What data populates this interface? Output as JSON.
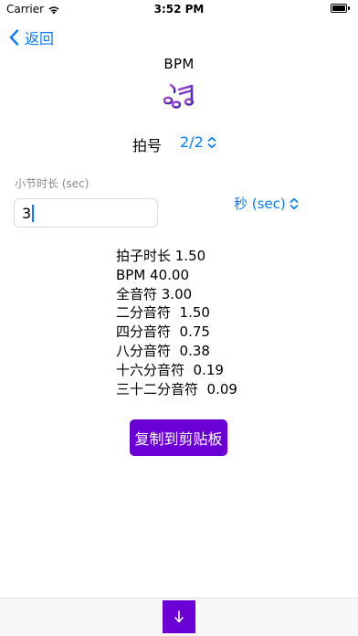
{
  "status_bar": {
    "carrier": "Carrier",
    "time": "3:52 PM"
  },
  "nav": {
    "back_label": "返回"
  },
  "header": {
    "title": "BPM"
  },
  "meter": {
    "label": "拍号",
    "value": "2/2"
  },
  "measure_duration": {
    "label": "小节时长 (sec)",
    "value": "3",
    "unit": "秒 (sec)"
  },
  "results": [
    "拍子时长 1.50",
    "BPM 40.00",
    "全音符 3.00",
    "二分音符  1.50",
    "四分音符  0.75",
    "八分音符  0.38",
    "十六分音符  0.19",
    "三十二分音符  0.09"
  ],
  "copy_button": {
    "label": "复制到剪贴板"
  },
  "colors": {
    "accent_blue": "#0a7afe",
    "brand_purple": "#6a00d6"
  },
  "icons": {
    "music": "music-notes-icon",
    "down": "arrow-down-icon",
    "back": "chevron-left-icon"
  }
}
